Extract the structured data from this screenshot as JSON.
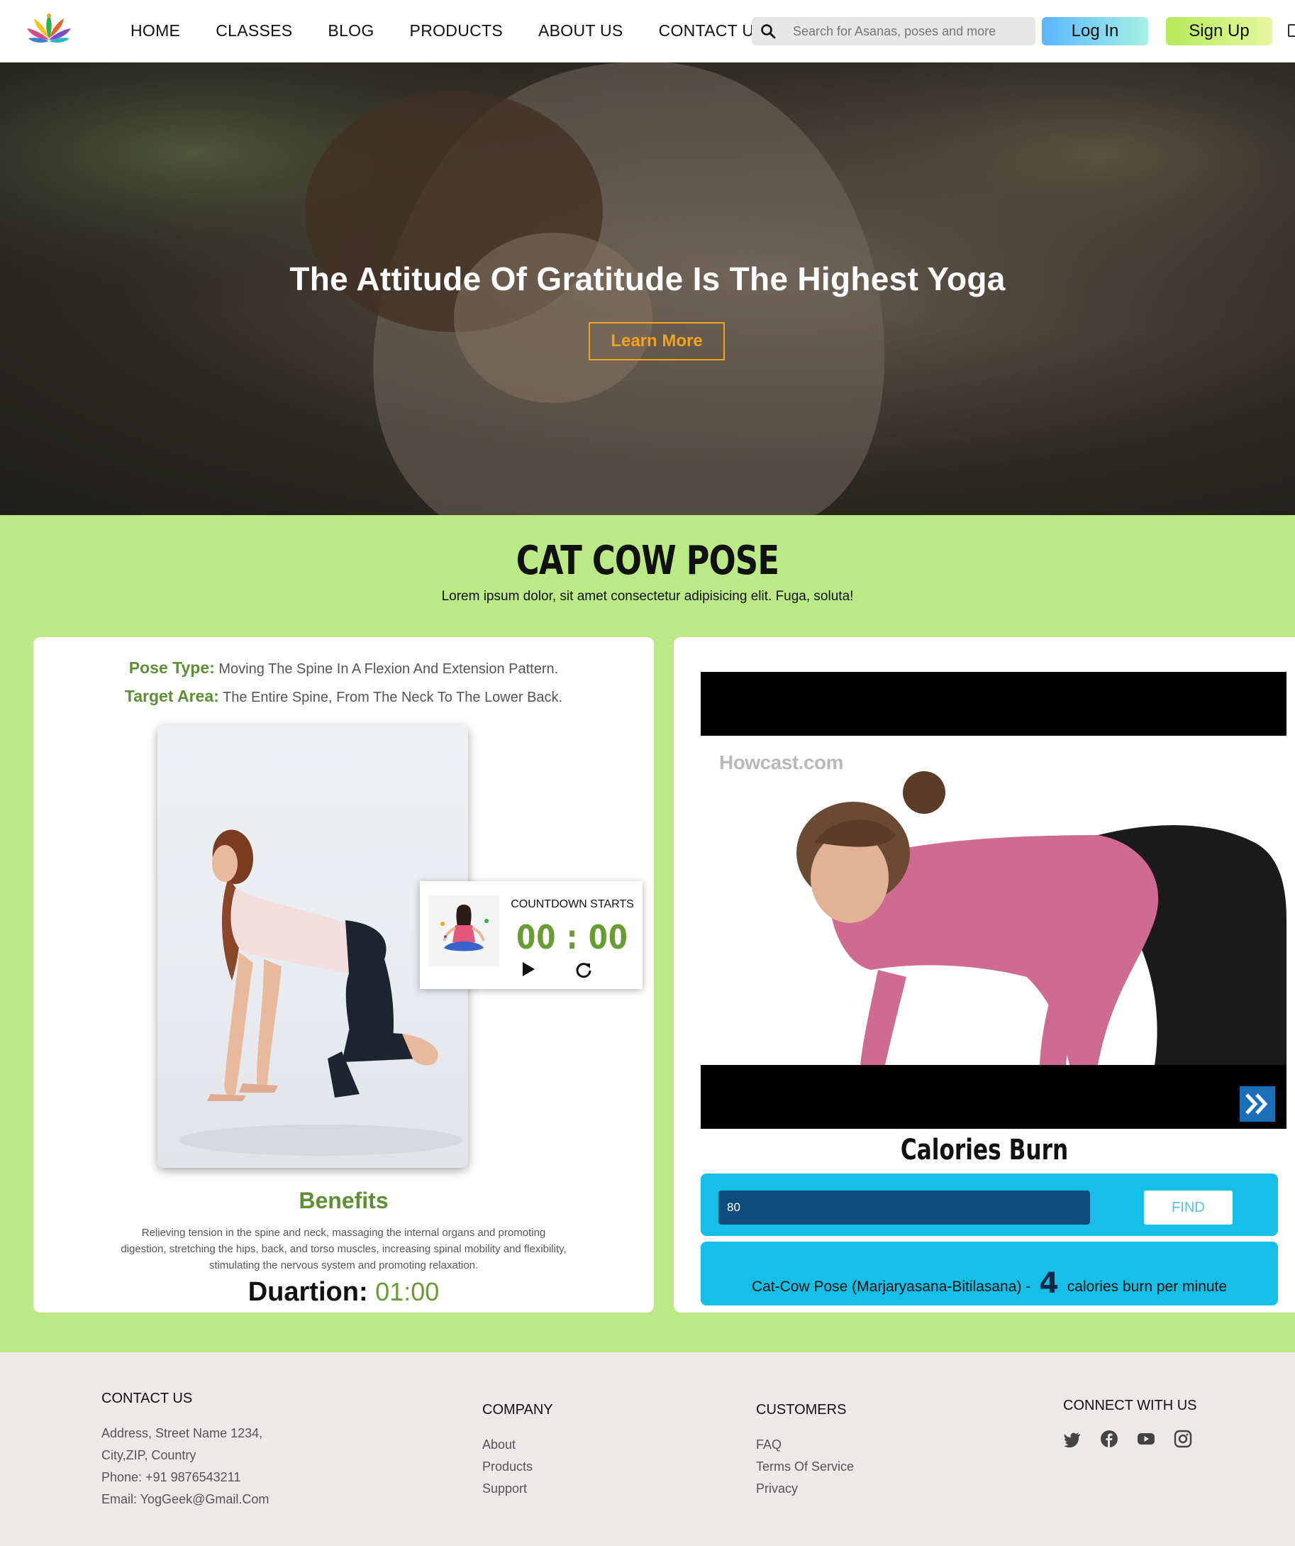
{
  "nav": {
    "links": [
      "HOME",
      "CLASSES",
      "BLOG",
      "PRODUCTS",
      "ABOUT US",
      "CONTACT US"
    ],
    "search_placeholder": "Search for Asanas, poses and more",
    "login_label": "Log In",
    "signup_label": "Sign Up"
  },
  "hero": {
    "title": "The Attitude Of Gratitude Is The Highest Yoga",
    "button_label": "Learn More"
  },
  "pose": {
    "title": "CAT COW POSE",
    "subtitle": "Lorem ipsum dolor, sit amet consectetur adipisicing elit. Fuga, soluta!",
    "pose_type_label": "Pose Type:",
    "pose_type_value": "Moving The Spine In A Flexion And Extension Pattern.",
    "target_area_label": "Target Area:",
    "target_area_value": "The Entire Spine, From The Neck To The Lower Back.",
    "countdown_label": "COUNTDOWN STARTS",
    "countdown_time": "00 : 00",
    "benefits_title": "Benefits",
    "benefits_text": "Relieving tension in the spine and neck, massaging the internal organs and promoting digestion, stretching the hips, back, and torso muscles, increasing spinal mobility and flexibility, stimulating the nervous system and promoting relaxation.",
    "duration_label": "Duartion:",
    "duration_value": "01:00"
  },
  "video": {
    "watermark": "Howcast.com"
  },
  "calories": {
    "title": "Calories Burn",
    "input_value": "80",
    "find_label": "FIND",
    "result_prefix": "Cat-Cow Pose (Marjaryasana-Bitilasana) -",
    "result_number": "4",
    "result_suffix": "calories burn per minute"
  },
  "footer": {
    "contact": {
      "heading": "CONTACT US",
      "lines": [
        "Address, Street Name 1234,",
        "City,ZIP, Country",
        "Phone: +91 9876543211",
        "Email: YogGeek@Gmail.Com"
      ]
    },
    "company": {
      "heading": "COMPANY",
      "items": [
        "About",
        "Products",
        "Support"
      ]
    },
    "customers": {
      "heading": "CUSTOMERS",
      "items": [
        "FAQ",
        "Terms Of Service",
        "Privacy"
      ]
    },
    "connect": {
      "heading": "CONNECT WITH US",
      "icons": [
        "twitter-icon",
        "facebook-icon",
        "youtube-icon",
        "instagram-icon"
      ]
    }
  },
  "colors": {
    "section_green": "#bbe985",
    "accent_green": "#6a9b35",
    "hero_button_orange": "#f3a21d",
    "calorie_blue": "#16bfe6",
    "input_navy": "#0f4c7c"
  }
}
